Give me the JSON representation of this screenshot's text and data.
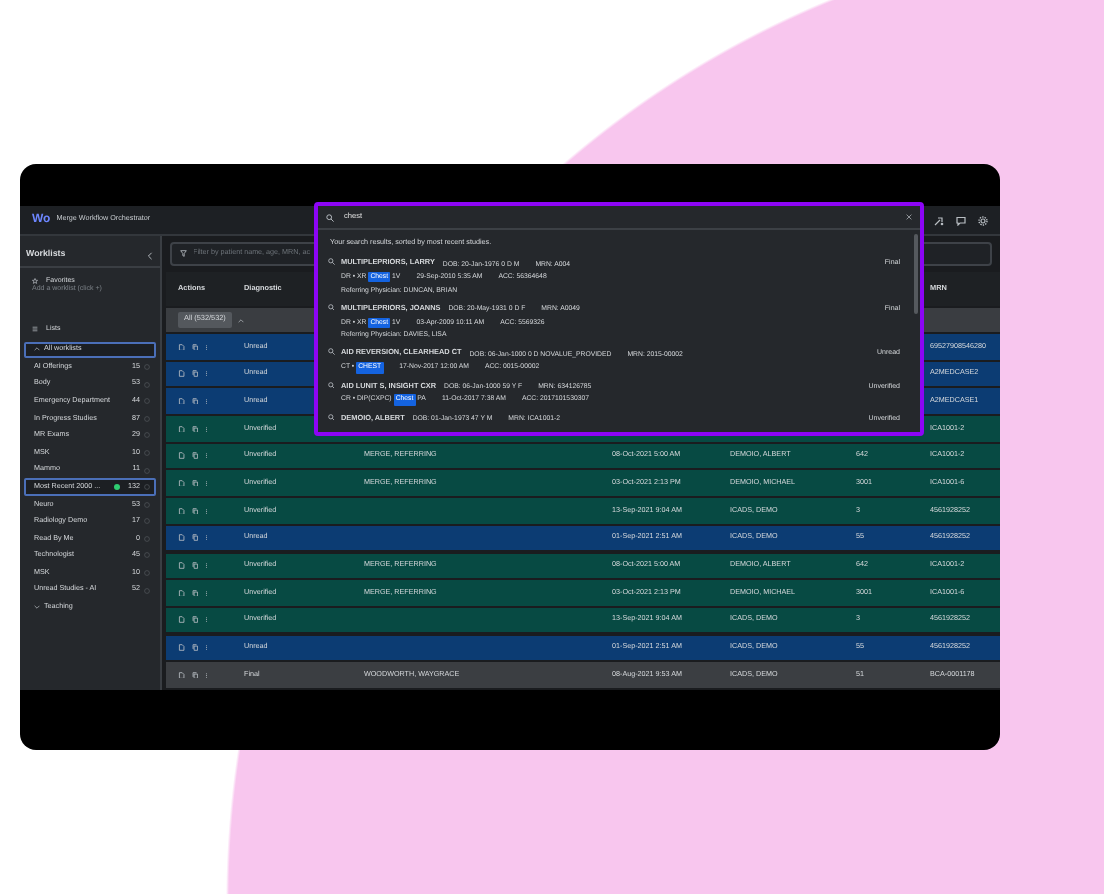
{
  "app": {
    "logo": "Wo",
    "title": "Merge Workflow Orchestrator"
  },
  "sidebar": {
    "title": "Worklists",
    "favorites_label": "Favorites",
    "favorites_hint": "Add a worklist (click +)",
    "lists_label": "Lists",
    "lists": [
      {
        "label": "All worklists",
        "expanded": true,
        "selected": true,
        "children": [
          {
            "label": "AI Offerings",
            "count": "15",
            "selected": false
          },
          {
            "label": "Body",
            "count": "53",
            "selected": false
          },
          {
            "label": "Emergency Department",
            "count": "44",
            "selected": false
          },
          {
            "label": "In Progress Studies",
            "count": "87",
            "selected": false
          },
          {
            "label": "MR Exams",
            "count": "29",
            "selected": false
          },
          {
            "label": "MSK",
            "count": "10",
            "selected": false
          },
          {
            "label": "Mammo",
            "count": "11",
            "selected": false
          },
          {
            "label": "Most Recent 2000 ...",
            "count": "132",
            "selected": true,
            "color": "#2ecc71"
          },
          {
            "label": "Neuro",
            "count": "53",
            "selected": false
          },
          {
            "label": "Radiology Demo",
            "count": "17",
            "selected": false
          },
          {
            "label": "Read By Me",
            "count": "0",
            "selected": false
          },
          {
            "label": "Technologist",
            "count": "45",
            "selected": false
          },
          {
            "label": "MSK",
            "count": "10",
            "selected": false
          },
          {
            "label": "Unread Studies - AI",
            "count": "52",
            "selected": false
          }
        ]
      },
      {
        "label": "Teaching",
        "expanded": false,
        "selected": false
      }
    ]
  },
  "filter": {
    "placeholder": "Filter by patient name, age, MRN, ac"
  },
  "table": {
    "headers": {
      "actions": "Actions",
      "status": "Diagnostic",
      "mrn": "MRN"
    },
    "group": "All (532/532)",
    "rows": [
      {
        "kind": "unread",
        "status": "Unread",
        "mrn": "69527908546280"
      },
      {
        "kind": "unread",
        "status": "Unread",
        "mrn": "A2MEDCASE2"
      },
      {
        "kind": "unread",
        "status": "Unread",
        "mrn": "A2MEDCASE1"
      },
      {
        "kind": "unverified",
        "status": "Unverified",
        "mrn": "ICA1001-2"
      },
      {
        "kind": "unverified",
        "status": "Unverified",
        "referring": "MERGE, REFERRING",
        "date": "08-Oct-2021 5:00 AM",
        "patient": "DEMOIO, ALBERT",
        "age": "642",
        "mrn": "ICA1001-2"
      },
      {
        "kind": "unverified",
        "status": "Unverified",
        "referring": "MERGE, REFERRING",
        "date": "03-Oct-2021 2:13 PM",
        "patient": "DEMOIO, MICHAEL",
        "age": "3001",
        "mrn": "ICA1001-6"
      },
      {
        "kind": "unverified",
        "status": "Unverified",
        "date": "13-Sep-2021 9:04 AM",
        "patient": "ICADS, DEMO",
        "age": "3",
        "mrn": "4561928252"
      },
      {
        "kind": "unread",
        "status": "Unread",
        "date": "01-Sep-2021 2:51 AM",
        "patient": "ICADS, DEMO",
        "age": "55",
        "mrn": "4561928252"
      },
      {
        "kind": "unverified",
        "status": "Unverified",
        "referring": "MERGE, REFERRING",
        "date": "08-Oct-2021 5:00 AM",
        "patient": "DEMOIO, ALBERT",
        "age": "642",
        "mrn": "ICA1001-2"
      },
      {
        "kind": "unverified",
        "status": "Unverified",
        "referring": "MERGE, REFERRING",
        "date": "03-Oct-2021 2:13 PM",
        "patient": "DEMOIO, MICHAEL",
        "age": "3001",
        "mrn": "ICA1001-6"
      },
      {
        "kind": "unverified",
        "status": "Unverified",
        "date": "13-Sep-2021 9:04 AM",
        "patient": "ICADS, DEMO",
        "age": "3",
        "mrn": "4561928252"
      },
      {
        "kind": "unread",
        "status": "Unread",
        "date": "01-Sep-2021 2:51 AM",
        "patient": "ICADS, DEMO",
        "age": "55",
        "mrn": "4561928252"
      },
      {
        "kind": "final",
        "status": "Final",
        "referring": "WOODWORTH, WAYGRACE",
        "date": "08-Aug-2021 9:53 AM",
        "patient": "ICADS, DEMO",
        "age": "51",
        "mrn": "BCA-0001178"
      }
    ]
  },
  "search": {
    "value": "chest",
    "intro": "Your search results, sorted by most recent studies.",
    "results": [
      {
        "name": "MULTIPLEPRIORS, LARRY",
        "dob": "DOB: 20-Jan-1976  0 D  M",
        "mrn": "MRN: A004",
        "modality": "DR • XR",
        "match": "Chest",
        "rest": "1V",
        "date": "29-Sep-2010 5:35 AM",
        "acc": "ACC: 56364648",
        "physician": "Referring Physician: DUNCAN, BRIAN",
        "status": "Final"
      },
      {
        "name": "MULTIPLEPRIORS, JOANNS",
        "dob": "DOB: 20-May-1931  0 D  F",
        "mrn": "MRN: A0049",
        "modality": "DR • XR",
        "match": "Chest",
        "rest": "1V",
        "date": "03-Apr-2009 10:11 AM",
        "acc": "ACC: 5569326",
        "physician": "Referring Physician: DAVIES, LISA",
        "status": "Final"
      },
      {
        "name": "AID REVERSION, CLEARHEAD CT",
        "dob": "DOB: 06-Jan-1000  0 D  NOVALUE_PROVIDED",
        "mrn": "MRN: 2015-00002",
        "modality": "CT •",
        "match": "CHEST",
        "date": "17-Nov-2017 12:00 AM",
        "acc": "ACC: 0015-00002",
        "status": "Unread"
      },
      {
        "name": "AID LUNIT S, INSIGHT CXR",
        "dob": "DOB: 06-Jan-1000  59 Y  F",
        "mrn": "MRN: 634126785",
        "modality": "CR • DIP(CXPC)",
        "match": "Chest",
        "rest": "PA",
        "date": "11-Oct-2017 7:38 AM",
        "acc": "ACC: 2017101530307",
        "status": "Unverified"
      },
      {
        "name": "DEMOIO, ALBERT",
        "dob": "DOB: 01-Jan-1973  47 Y  M",
        "mrn": "MRN: ICA1001-2",
        "status": "Unverified"
      }
    ]
  }
}
